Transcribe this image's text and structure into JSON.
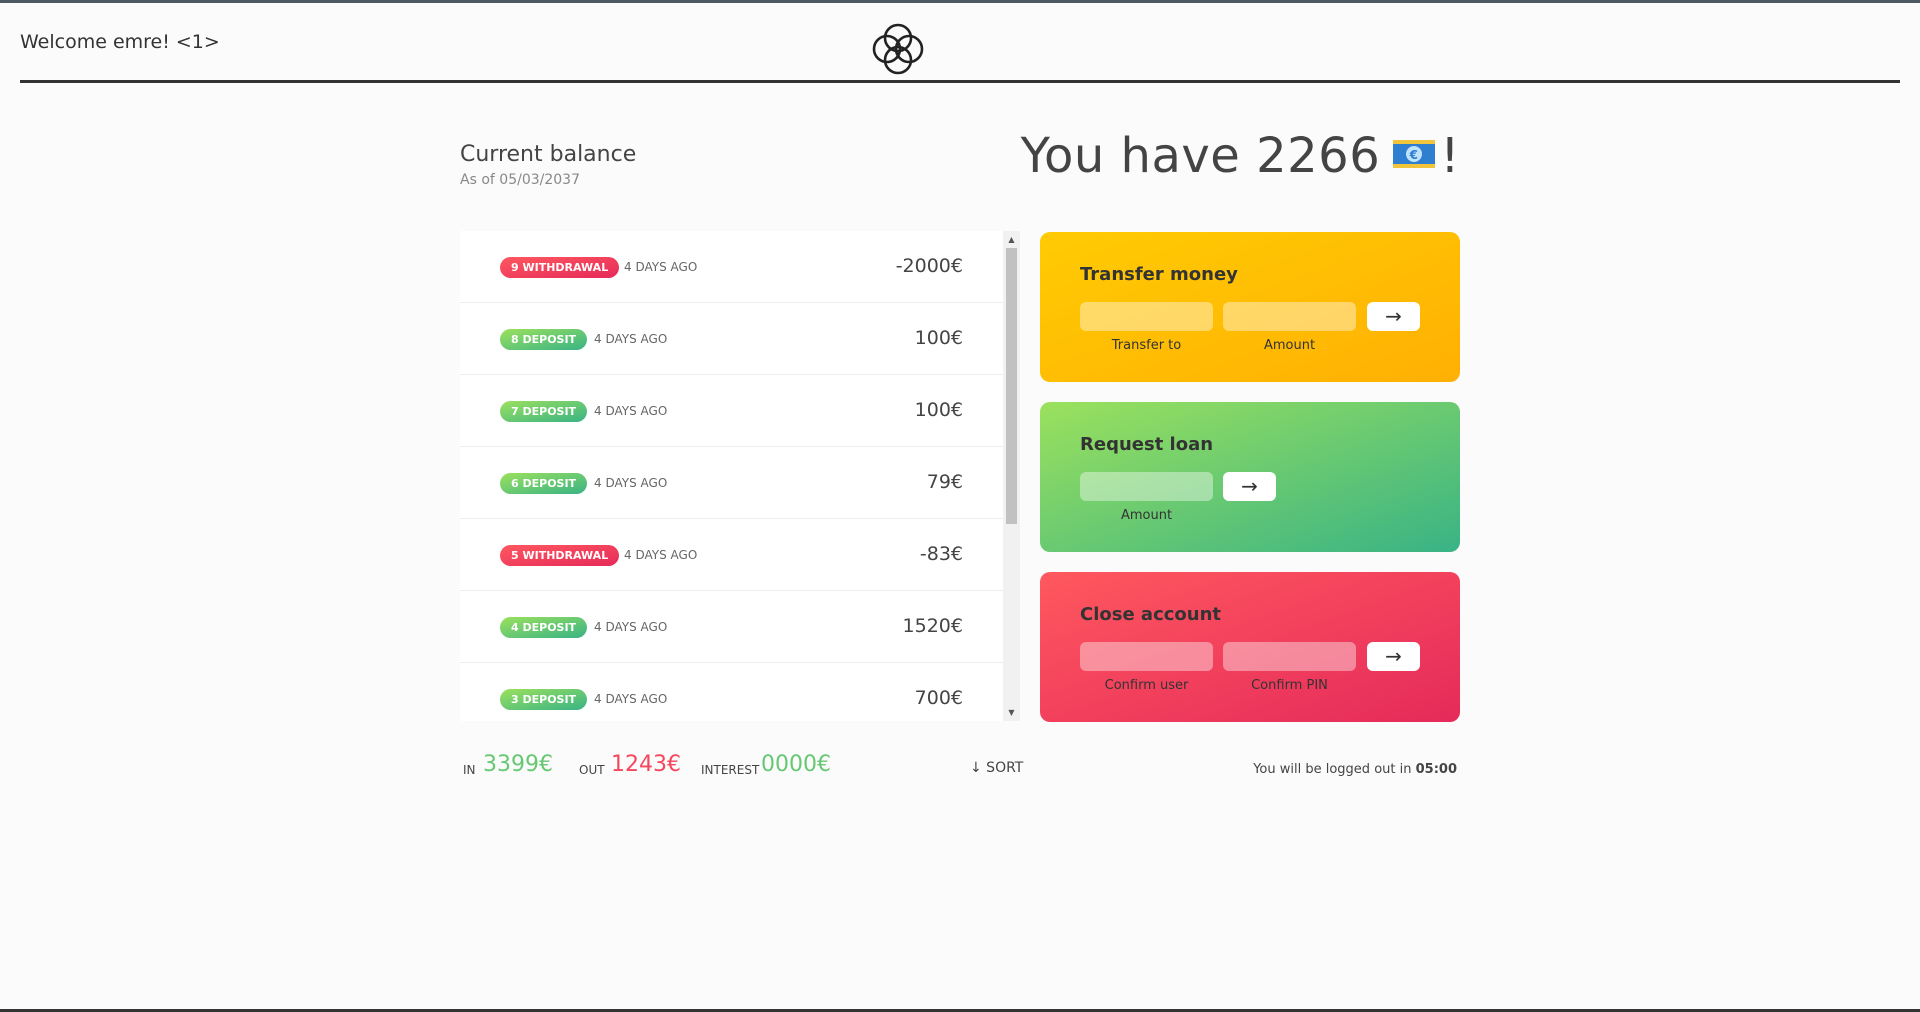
{
  "nav": {
    "welcome": "Welcome emre! <1>",
    "logo_icon": "four-circles-logo-icon"
  },
  "balance": {
    "title": "Current balance",
    "date_prefix": "As of",
    "date": "05/03/2037",
    "text_prefix": "You have",
    "amount": "2266",
    "icon": "banknote-euro-icon",
    "suffix": "!"
  },
  "movements": [
    {
      "type": "9 withdrawal",
      "kind": "withdrawal",
      "date": "4 days ago",
      "value": "-2000€"
    },
    {
      "type": "8 deposit",
      "kind": "deposit",
      "date": "4 days ago",
      "value": "100€"
    },
    {
      "type": "7 deposit",
      "kind": "deposit",
      "date": "4 days ago",
      "value": "100€"
    },
    {
      "type": "6 deposit",
      "kind": "deposit",
      "date": "4 days ago",
      "value": "79€"
    },
    {
      "type": "5 withdrawal",
      "kind": "withdrawal",
      "date": "4 days ago",
      "value": "-83€"
    },
    {
      "type": "4 deposit",
      "kind": "deposit",
      "date": "4 days ago",
      "value": "1520€"
    },
    {
      "type": "3 deposit",
      "kind": "deposit",
      "date": "4 days ago",
      "value": "700€"
    }
  ],
  "summary": {
    "in_label": "In",
    "in_value": "3399€",
    "out_label": "Out",
    "out_value": "1243€",
    "interest_label": "Interest",
    "interest_value": "0000€",
    "sort_label": "↓ SORT"
  },
  "operations": {
    "transfer": {
      "title": "Transfer money",
      "to_label": "Transfer to",
      "to_value": "",
      "amount_label": "Amount",
      "amount_value": "",
      "button": "→"
    },
    "loan": {
      "title": "Request loan",
      "amount_label": "Amount",
      "amount_value": "",
      "button": "→"
    },
    "close": {
      "title": "Close account",
      "user_label": "Confirm user",
      "user_value": "",
      "pin_label": "Confirm PIN",
      "pin_value": "",
      "button": "→"
    }
  },
  "logout": {
    "text": "You will be logged out in",
    "time": "05:00"
  },
  "colors": {
    "deposit": "#66c873",
    "withdrawal": "#f5465d",
    "transfer_bg": "#ffbf03",
    "loan_bg": "#6cca72",
    "close_bg": "#f04060"
  }
}
